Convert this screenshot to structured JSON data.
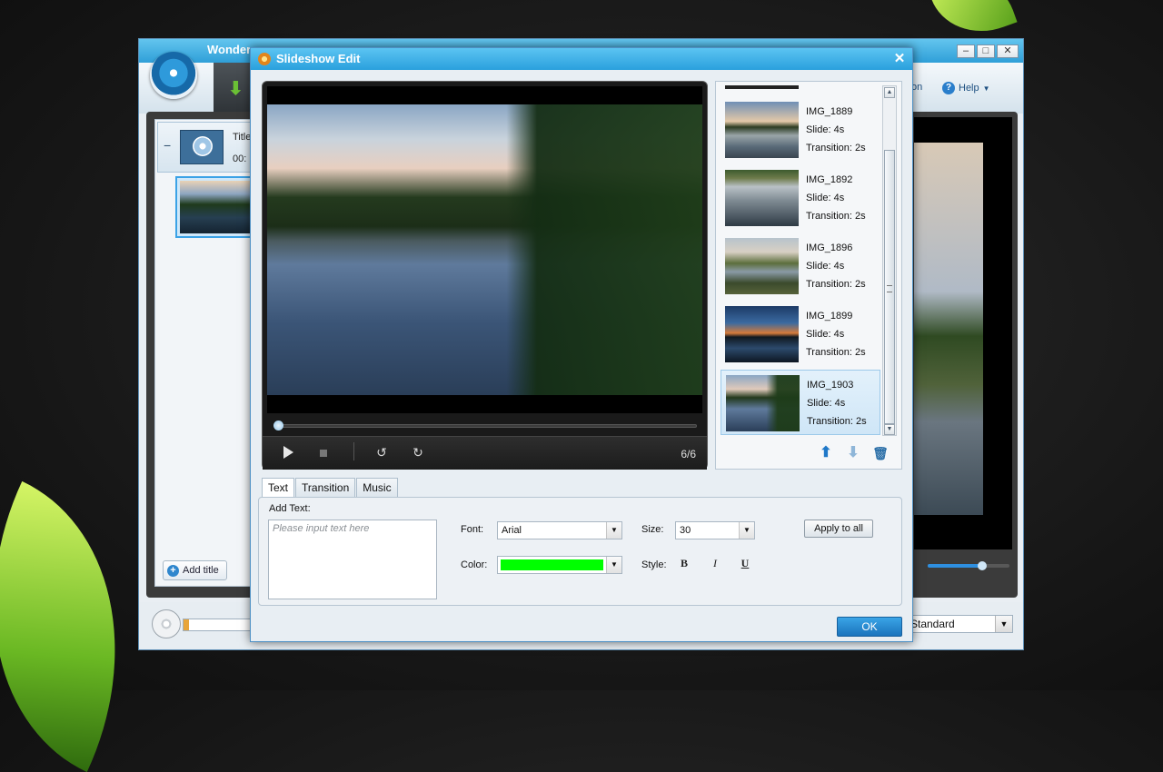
{
  "main_window": {
    "title": "Wonder",
    "window_buttons": {
      "minimize": "–",
      "maximize": "□",
      "close": "✕"
    },
    "help_label": "Help",
    "help_partial": "on",
    "title_item": {
      "label": "Title",
      "duration": "00:"
    },
    "add_title_label": "Add title",
    "quality_select": "Standard"
  },
  "dialog": {
    "title": "Slideshow Edit",
    "close": "✕",
    "player": {
      "counter": "6/6"
    },
    "slides": [
      {
        "name": "IMG_1889",
        "slide": "Slide: 4s",
        "transition": "Transition: 2s"
      },
      {
        "name": "IMG_1892",
        "slide": "Slide: 4s",
        "transition": "Transition: 2s"
      },
      {
        "name": "IMG_1896",
        "slide": "Slide: 4s",
        "transition": "Transition: 2s"
      },
      {
        "name": "IMG_1899",
        "slide": "Slide: 4s",
        "transition": "Transition: 2s"
      },
      {
        "name": "IMG_1903",
        "slide": "Slide: 4s",
        "transition": "Transition: 2s"
      }
    ],
    "tabs": [
      "Text",
      "Transition",
      "Music"
    ],
    "text_panel": {
      "add_text_label": "Add Text:",
      "placeholder": "Please input text here",
      "font_label": "Font:",
      "font_value": "Arial",
      "size_label": "Size:",
      "size_value": "30",
      "apply_label": "Apply to all",
      "color_label": "Color:",
      "color_value": "#00ff00",
      "style_label": "Style:",
      "style_bold": "B",
      "style_italic": "I",
      "style_underline": "U"
    },
    "ok_label": "OK"
  },
  "icons": {
    "play": "play-icon",
    "stop": "stop-icon",
    "rotate_left": "rotate-left-icon",
    "rotate_right": "rotate-right-icon",
    "move_up": "arrow-up-icon",
    "move_down": "arrow-down-icon",
    "delete": "trash-icon"
  },
  "colors": {
    "title_bar": "#2aa0dd",
    "accent_blue": "#1b74bd",
    "text_color": "#00ff00"
  }
}
